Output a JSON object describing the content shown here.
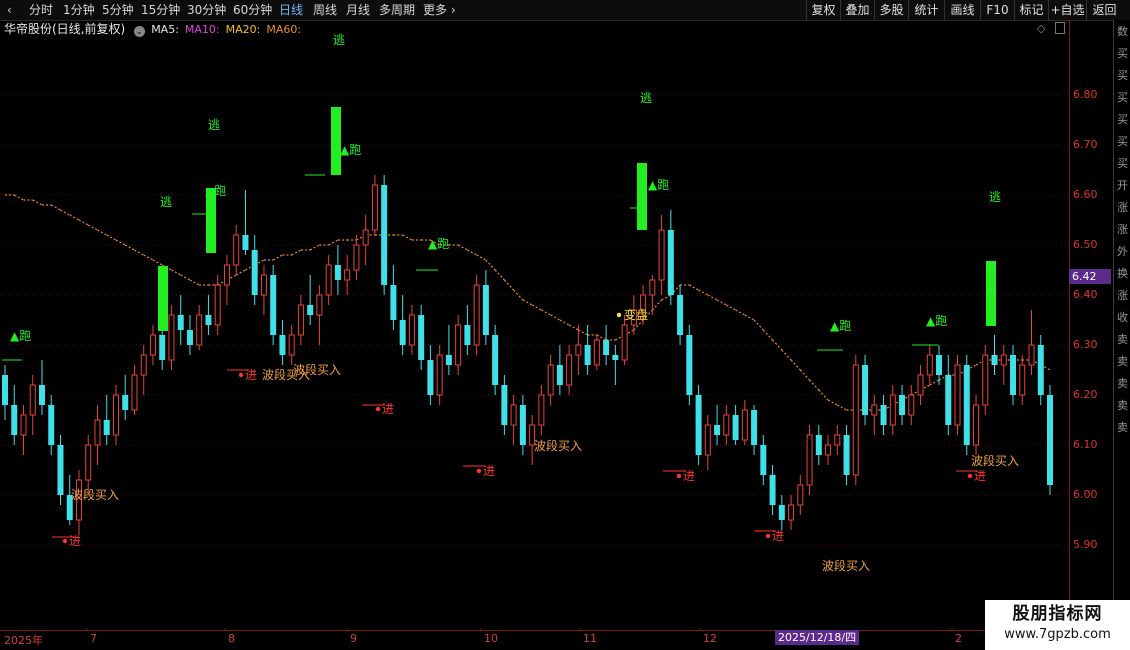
{
  "toolbar": {
    "tabs": [
      {
        "label": "分时",
        "active": false
      },
      {
        "label": "1分钟",
        "active": false
      },
      {
        "label": "5分钟",
        "active": false
      },
      {
        "label": "15分钟",
        "active": false
      },
      {
        "label": "30分钟",
        "active": false
      },
      {
        "label": "60分钟",
        "active": false
      },
      {
        "label": "日线",
        "active": true
      },
      {
        "label": "周线",
        "active": false
      },
      {
        "label": "月线",
        "active": false
      },
      {
        "label": "多周期",
        "active": false
      },
      {
        "label": "更多 ›",
        "active": false
      }
    ],
    "right_buttons": [
      "复权",
      "叠加",
      "多股",
      "统计",
      "画线",
      "F10",
      "标记",
      "+自选",
      "返回"
    ]
  },
  "legend": {
    "stock": "华帝股份(日线,前复权)",
    "items": [
      {
        "label": "MA5:",
        "color": "#e6e6e6"
      },
      {
        "label": "MA10:",
        "color": "#e040e0"
      },
      {
        "label": "MA20:",
        "color": "#f0c020"
      },
      {
        "label": "MA60:",
        "color": "#e8902a"
      }
    ]
  },
  "y_axis": {
    "labels": [
      "6.80",
      "6.70",
      "6.60",
      "6.50",
      "6.40",
      "6.30",
      "6.20",
      "6.10",
      "6.00",
      "5.90"
    ],
    "current_price": "6.42"
  },
  "x_axis": {
    "labels": [
      "2025年",
      "7",
      "8",
      "9",
      "10",
      "11",
      "12",
      "2"
    ],
    "highlight": "2025/12/18/四"
  },
  "signals": {
    "run": "▲跑",
    "escape": "逃",
    "enter": "进",
    "wave_buy": "波段买入",
    "change": "变盘"
  },
  "side_panel": [
    "数",
    "买",
    "买",
    "买",
    "买",
    "买",
    "买",
    "开",
    "涨",
    "涨",
    "外",
    "换",
    "涨",
    "收",
    "卖",
    "卖",
    "卖",
    "卖",
    "卖"
  ],
  "watermark": {
    "title": "股朋指标网",
    "url": "www.7gpzb.com"
  },
  "colors": {
    "up": "#e8443a",
    "down": "#3fe0e8",
    "signal_green": "#22ee22",
    "ma60": "#e8902a",
    "label_orange": "#f0a040"
  },
  "chart_data": {
    "type": "candlestick",
    "y_range": [
      5.86,
      6.86
    ],
    "candles": [
      [
        6.24,
        6.26,
        6.15,
        6.18
      ],
      [
        6.18,
        6.22,
        6.1,
        6.12
      ],
      [
        6.12,
        6.18,
        6.08,
        6.16
      ],
      [
        6.16,
        6.24,
        6.12,
        6.22
      ],
      [
        6.22,
        6.27,
        6.16,
        6.18
      ],
      [
        6.18,
        6.2,
        6.08,
        6.1
      ],
      [
        6.1,
        6.12,
        5.98,
        6.0
      ],
      [
        6.0,
        6.04,
        5.94,
        5.95
      ],
      [
        5.95,
        6.05,
        5.92,
        6.03
      ],
      [
        6.03,
        6.12,
        6.0,
        6.1
      ],
      [
        6.1,
        6.18,
        6.06,
        6.15
      ],
      [
        6.15,
        6.2,
        6.1,
        6.12
      ],
      [
        6.12,
        6.22,
        6.1,
        6.2
      ],
      [
        6.2,
        6.24,
        6.15,
        6.17
      ],
      [
        6.17,
        6.26,
        6.16,
        6.24
      ],
      [
        6.24,
        6.3,
        6.2,
        6.28
      ],
      [
        6.28,
        6.34,
        6.26,
        6.32
      ],
      [
        6.32,
        6.36,
        6.25,
        6.27
      ],
      [
        6.27,
        6.38,
        6.25,
        6.36
      ],
      [
        6.36,
        6.4,
        6.3,
        6.33
      ],
      [
        6.33,
        6.36,
        6.28,
        6.3
      ],
      [
        6.3,
        6.38,
        6.29,
        6.36
      ],
      [
        6.36,
        6.4,
        6.32,
        6.34
      ],
      [
        6.34,
        6.44,
        6.32,
        6.42
      ],
      [
        6.42,
        6.48,
        6.38,
        6.46
      ],
      [
        6.46,
        6.54,
        6.44,
        6.52
      ],
      [
        6.52,
        6.61,
        6.48,
        6.49
      ],
      [
        6.49,
        6.52,
        6.38,
        6.4
      ],
      [
        6.4,
        6.46,
        6.36,
        6.44
      ],
      [
        6.44,
        6.46,
        6.3,
        6.32
      ],
      [
        6.32,
        6.35,
        6.26,
        6.28
      ],
      [
        6.28,
        6.34,
        6.26,
        6.32
      ],
      [
        6.32,
        6.4,
        6.3,
        6.38
      ],
      [
        6.38,
        6.44,
        6.34,
        6.36
      ],
      [
        6.36,
        6.42,
        6.3,
        6.4
      ],
      [
        6.4,
        6.48,
        6.38,
        6.46
      ],
      [
        6.46,
        6.5,
        6.4,
        6.43
      ],
      [
        6.43,
        6.48,
        6.4,
        6.45
      ],
      [
        6.45,
        6.52,
        6.43,
        6.5
      ],
      [
        6.5,
        6.56,
        6.46,
        6.53
      ],
      [
        6.53,
        6.64,
        6.52,
        6.62
      ],
      [
        6.62,
        6.64,
        6.4,
        6.42
      ],
      [
        6.42,
        6.46,
        6.33,
        6.35
      ],
      [
        6.35,
        6.4,
        6.28,
        6.3
      ],
      [
        6.3,
        6.38,
        6.28,
        6.36
      ],
      [
        6.36,
        6.38,
        6.25,
        6.27
      ],
      [
        6.27,
        6.3,
        6.18,
        6.2
      ],
      [
        6.2,
        6.3,
        6.18,
        6.28
      ],
      [
        6.28,
        6.34,
        6.24,
        6.26
      ],
      [
        6.26,
        6.36,
        6.24,
        6.34
      ],
      [
        6.34,
        6.38,
        6.28,
        6.3
      ],
      [
        6.3,
        6.44,
        6.28,
        6.42
      ],
      [
        6.42,
        6.45,
        6.3,
        6.32
      ],
      [
        6.32,
        6.34,
        6.2,
        6.22
      ],
      [
        6.22,
        6.24,
        6.12,
        6.14
      ],
      [
        6.14,
        6.2,
        6.1,
        6.18
      ],
      [
        6.18,
        6.2,
        6.08,
        6.1
      ],
      [
        6.1,
        6.16,
        6.06,
        6.14
      ],
      [
        6.14,
        6.22,
        6.12,
        6.2
      ],
      [
        6.2,
        6.28,
        6.18,
        6.26
      ],
      [
        6.26,
        6.3,
        6.2,
        6.22
      ],
      [
        6.22,
        6.3,
        6.2,
        6.28
      ],
      [
        6.28,
        6.34,
        6.24,
        6.3
      ],
      [
        6.3,
        6.34,
        6.24,
        6.26
      ],
      [
        6.26,
        6.32,
        6.25,
        6.31
      ],
      [
        6.31,
        6.34,
        6.26,
        6.28
      ],
      [
        6.28,
        6.3,
        6.22,
        6.27
      ],
      [
        6.27,
        6.36,
        6.26,
        6.34
      ],
      [
        6.34,
        6.4,
        6.32,
        6.37
      ],
      [
        6.37,
        6.42,
        6.34,
        6.4
      ],
      [
        6.4,
        6.44,
        6.36,
        6.43
      ],
      [
        6.43,
        6.56,
        6.4,
        6.53
      ],
      [
        6.53,
        6.57,
        6.38,
        6.4
      ],
      [
        6.4,
        6.42,
        6.3,
        6.32
      ],
      [
        6.32,
        6.34,
        6.18,
        6.2
      ],
      [
        6.2,
        6.22,
        6.06,
        6.08
      ],
      [
        6.08,
        6.16,
        6.05,
        6.14
      ],
      [
        6.14,
        6.18,
        6.1,
        6.12
      ],
      [
        6.12,
        6.18,
        6.1,
        6.16
      ],
      [
        6.16,
        6.18,
        6.1,
        6.11
      ],
      [
        6.11,
        6.19,
        6.1,
        6.17
      ],
      [
        6.17,
        6.18,
        6.08,
        6.1
      ],
      [
        6.1,
        6.12,
        6.02,
        6.04
      ],
      [
        6.04,
        6.06,
        5.96,
        5.98
      ],
      [
        5.98,
        6.0,
        5.93,
        5.95
      ],
      [
        5.95,
        6.0,
        5.93,
        5.98
      ],
      [
        5.98,
        6.04,
        5.96,
        6.02
      ],
      [
        6.02,
        6.14,
        6.0,
        6.12
      ],
      [
        6.12,
        6.14,
        6.06,
        6.08
      ],
      [
        6.08,
        6.12,
        6.06,
        6.1
      ],
      [
        6.1,
        6.14,
        6.08,
        6.12
      ],
      [
        6.12,
        6.14,
        6.02,
        6.04
      ],
      [
        6.04,
        6.28,
        6.02,
        6.26
      ],
      [
        6.26,
        6.28,
        6.14,
        6.16
      ],
      [
        6.16,
        6.2,
        6.12,
        6.18
      ],
      [
        6.18,
        6.2,
        6.12,
        6.14
      ],
      [
        6.14,
        6.22,
        6.12,
        6.2
      ],
      [
        6.2,
        6.22,
        6.14,
        6.16
      ],
      [
        6.16,
        6.22,
        6.14,
        6.2
      ],
      [
        6.2,
        6.26,
        6.18,
        6.24
      ],
      [
        6.24,
        6.3,
        6.22,
        6.28
      ],
      [
        6.28,
        6.3,
        6.22,
        6.24
      ],
      [
        6.24,
        6.28,
        6.12,
        6.14
      ],
      [
        6.14,
        6.28,
        6.12,
        6.26
      ],
      [
        6.26,
        6.28,
        6.08,
        6.1
      ],
      [
        6.1,
        6.2,
        6.08,
        6.18
      ],
      [
        6.18,
        6.3,
        6.16,
        6.28
      ],
      [
        6.28,
        6.32,
        6.24,
        6.26
      ],
      [
        6.26,
        6.3,
        6.22,
        6.28
      ],
      [
        6.28,
        6.3,
        6.18,
        6.2
      ],
      [
        6.2,
        6.28,
        6.18,
        6.26
      ],
      [
        6.26,
        6.37,
        6.24,
        6.3
      ],
      [
        6.3,
        6.32,
        6.18,
        6.2
      ],
      [
        6.2,
        6.22,
        6.0,
        6.02
      ]
    ],
    "ma60": [
      6.6,
      6.6,
      6.59,
      6.59,
      6.58,
      6.58,
      6.57,
      6.56,
      6.55,
      6.54,
      6.53,
      6.52,
      6.51,
      6.5,
      6.49,
      6.48,
      6.47,
      6.46,
      6.45,
      6.44,
      6.43,
      6.42,
      6.42,
      6.42,
      6.43,
      6.44,
      6.45,
      6.46,
      6.47,
      6.47,
      6.48,
      6.48,
      6.49,
      6.49,
      6.5,
      6.5,
      6.51,
      6.51,
      6.51,
      6.52,
      6.52,
      6.52,
      6.52,
      6.52,
      6.51,
      6.51,
      6.51,
      6.5,
      6.5,
      6.5,
      6.49,
      6.48,
      6.47,
      6.45,
      6.43,
      6.41,
      6.39,
      6.38,
      6.37,
      6.36,
      6.35,
      6.34,
      6.33,
      6.32,
      6.32,
      6.31,
      6.31,
      6.32,
      6.33,
      6.35,
      6.37,
      6.39,
      6.4,
      6.42,
      6.42,
      6.41,
      6.4,
      6.39,
      6.38,
      6.37,
      6.36,
      6.35,
      6.33,
      6.31,
      6.29,
      6.27,
      6.25,
      6.23,
      6.21,
      6.19,
      6.18,
      6.17,
      6.17,
      6.17,
      6.17,
      6.17,
      6.18,
      6.19,
      6.2,
      6.21,
      6.22,
      6.23,
      6.24,
      6.24,
      6.25,
      6.26,
      6.27,
      6.27,
      6.27,
      6.27,
      6.27,
      6.27,
      6.26,
      6.25
    ]
  }
}
